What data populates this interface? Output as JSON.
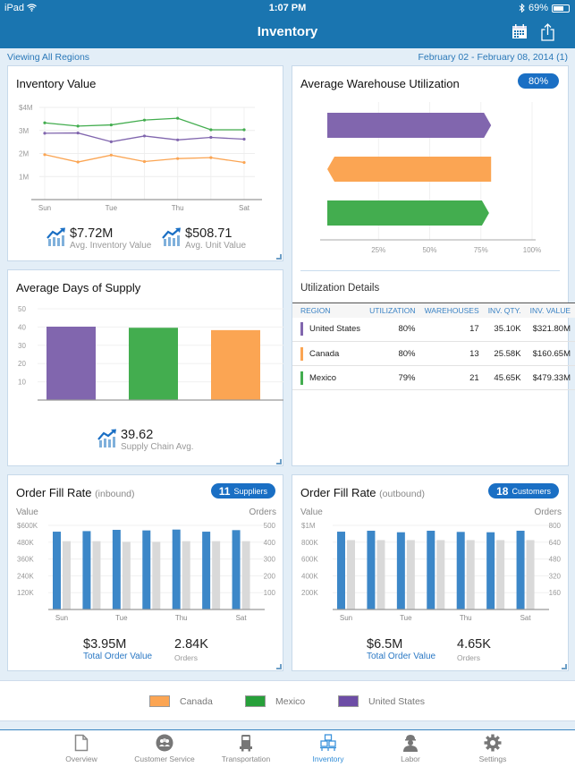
{
  "status_bar": {
    "device": "iPad",
    "time": "1:07 PM",
    "battery": "69%",
    "battery_level": 0.69
  },
  "nav": {
    "title": "Inventory",
    "icons": [
      "calendar-icon",
      "share-icon"
    ]
  },
  "subheader": {
    "scope": "Viewing All Regions",
    "date_range": "February 02 - February 08, 2014 (1)"
  },
  "colors": {
    "canada": "#fba553",
    "mexico": "#43ad4f",
    "united_states": "#8166ae",
    "accent": "#1a75b0",
    "value_bar": "#3c87c8",
    "orders_bar": "#d9d9d9"
  },
  "inventory_value": {
    "title": "Inventory Value",
    "kpis": [
      {
        "value": "$7.72M",
        "label": "Avg. Inventory Value"
      },
      {
        "value": "$508.71",
        "label": "Avg. Unit Value"
      }
    ]
  },
  "warehouse_utilization": {
    "title": "Average Warehouse Utilization",
    "badge": "80%",
    "details_title": "Utilization Details",
    "columns": [
      "REGION",
      "UTILIZATION",
      "WAREHOUSES",
      "INV. QTY.",
      "INV. VALUE"
    ],
    "rows": [
      {
        "region": "United States",
        "color": "#8166ae",
        "utilization": "80%",
        "warehouses": "17",
        "inv_qty": "35.10K",
        "inv_value": "$321.80M"
      },
      {
        "region": "Canada",
        "color": "#fba553",
        "utilization": "80%",
        "warehouses": "13",
        "inv_qty": "25.58K",
        "inv_value": "$160.65M"
      },
      {
        "region": "Mexico",
        "color": "#43ad4f",
        "utilization": "79%",
        "warehouses": "21",
        "inv_qty": "45.65K",
        "inv_value": "$479.33M"
      }
    ]
  },
  "days_supply": {
    "title": "Average Days of Supply",
    "kpi": {
      "value": "39.62",
      "label": "Supply Chain Avg."
    }
  },
  "fill_inbound": {
    "title": "Order Fill Rate",
    "qualifier": "(inbound)",
    "badge_count": "11",
    "badge_label": "Suppliers",
    "total_value": "$3.95M",
    "total_value_label": "Total Order Value",
    "orders": "2.84K",
    "orders_label": "Orders"
  },
  "fill_outbound": {
    "title": "Order Fill Rate",
    "qualifier": "(outbound)",
    "badge_count": "18",
    "badge_label": "Customers",
    "total_value": "$6.5M",
    "total_value_label": "Total Order Value",
    "orders": "4.65K",
    "orders_label": "Orders"
  },
  "legend": [
    {
      "label": "Canada",
      "color": "#fba553"
    },
    {
      "label": "Mexico",
      "color": "#27a03a"
    },
    {
      "label": "United States",
      "color": "#6d4da6"
    }
  ],
  "tabs": [
    {
      "label": "Overview",
      "icon": "document-icon",
      "active": false
    },
    {
      "label": "Customer Service",
      "icon": "people-icon",
      "active": false
    },
    {
      "label": "Transportation",
      "icon": "truck-icon",
      "active": false
    },
    {
      "label": "Inventory",
      "icon": "boxes-icon",
      "active": true
    },
    {
      "label": "Labor",
      "icon": "worker-icon",
      "active": false
    },
    {
      "label": "Settings",
      "icon": "gear-icon",
      "active": false
    }
  ],
  "chart_data": [
    {
      "id": "inventory_value",
      "type": "line",
      "title": "Inventory Value",
      "x": [
        "Sun",
        "Mon",
        "Tue",
        "Wed",
        "Thu",
        "Fri",
        "Sat"
      ],
      "x_tick_labels": [
        "Sun",
        "",
        "Tue",
        "",
        "Thu",
        "",
        "Sat"
      ],
      "y_ticks": [
        "1M",
        "2M",
        "3M",
        "$4M"
      ],
      "ylim": [
        0,
        4000000
      ],
      "grid": true,
      "series": [
        {
          "name": "Mexico",
          "color": "#43ad4f",
          "values": [
            3330000,
            3190000,
            3240000,
            3450000,
            3530000,
            3030000,
            3030000
          ]
        },
        {
          "name": "United States",
          "color": "#8166ae",
          "values": [
            2880000,
            2890000,
            2510000,
            2760000,
            2590000,
            2700000,
            2620000
          ]
        },
        {
          "name": "Canada",
          "color": "#fba553",
          "values": [
            1950000,
            1630000,
            1930000,
            1650000,
            1780000,
            1820000,
            1610000
          ]
        }
      ]
    },
    {
      "id": "warehouse_utilization",
      "type": "bar",
      "orientation": "horizontal",
      "title": "Average Warehouse Utilization",
      "categories": [
        "United States",
        "Canada",
        "Mexico"
      ],
      "values": [
        80,
        80,
        79
      ],
      "colors": [
        "#8166ae",
        "#fba553",
        "#43ad4f"
      ],
      "x_ticks": [
        "25%",
        "50%",
        "75%",
        "100%"
      ],
      "xlim": [
        0,
        100
      ]
    },
    {
      "id": "days_supply",
      "type": "bar",
      "title": "Average Days of Supply",
      "categories": [
        "United States",
        "Mexico",
        "Canada"
      ],
      "values": [
        40.2,
        39.6,
        38.3
      ],
      "colors": [
        "#8166ae",
        "#43ad4f",
        "#fba553"
      ],
      "y_ticks": [
        "10",
        "20",
        "30",
        "40",
        "50"
      ],
      "ylim": [
        0,
        50
      ]
    },
    {
      "id": "fill_inbound",
      "type": "bar",
      "title": "Order Fill Rate (inbound)",
      "categories": [
        "Sun",
        "Mon",
        "Tue",
        "Wed",
        "Thu",
        "Fri",
        "Sat"
      ],
      "x_tick_labels": [
        "Sun",
        "",
        "Tue",
        "",
        "Thu",
        "",
        "Sat"
      ],
      "ylabel": "Value",
      "y2label": "Orders",
      "ylim": [
        0,
        600000
      ],
      "y2lim": [
        0,
        500
      ],
      "y_ticks": [
        "120K",
        "240K",
        "360K",
        "480K",
        "$600K"
      ],
      "y2_ticks": [
        "100",
        "200",
        "300",
        "400",
        "500"
      ],
      "series": [
        {
          "name": "Value",
          "axis": "left",
          "color": "#3c87c8",
          "values": [
            555000,
            559000,
            568000,
            564000,
            570000,
            555000,
            566000
          ]
        },
        {
          "name": "Orders",
          "axis": "right",
          "color": "#d9d9d9",
          "values": [
            406,
            406,
            402,
            402,
            406,
            406,
            406
          ]
        }
      ]
    },
    {
      "id": "fill_outbound",
      "type": "bar",
      "title": "Order Fill Rate (outbound)",
      "categories": [
        "Sun",
        "Mon",
        "Tue",
        "Wed",
        "Thu",
        "Fri",
        "Sat"
      ],
      "x_tick_labels": [
        "Sun",
        "",
        "Tue",
        "",
        "Thu",
        "",
        "Sat"
      ],
      "ylabel": "Value",
      "y2label": "Orders",
      "ylim": [
        0,
        1000000
      ],
      "y2lim": [
        0,
        800
      ],
      "y_ticks": [
        "200K",
        "400K",
        "600K",
        "800K",
        "$1M"
      ],
      "y2_ticks": [
        "160",
        "320",
        "480",
        "640",
        "800"
      ],
      "series": [
        {
          "name": "Value",
          "axis": "left",
          "color": "#3c87c8",
          "values": [
            925000,
            936000,
            918000,
            936000,
            922000,
            918000,
            936000
          ]
        },
        {
          "name": "Orders",
          "axis": "right",
          "color": "#d9d9d9",
          "values": [
            660,
            660,
            660,
            660,
            660,
            660,
            660
          ]
        }
      ]
    }
  ]
}
